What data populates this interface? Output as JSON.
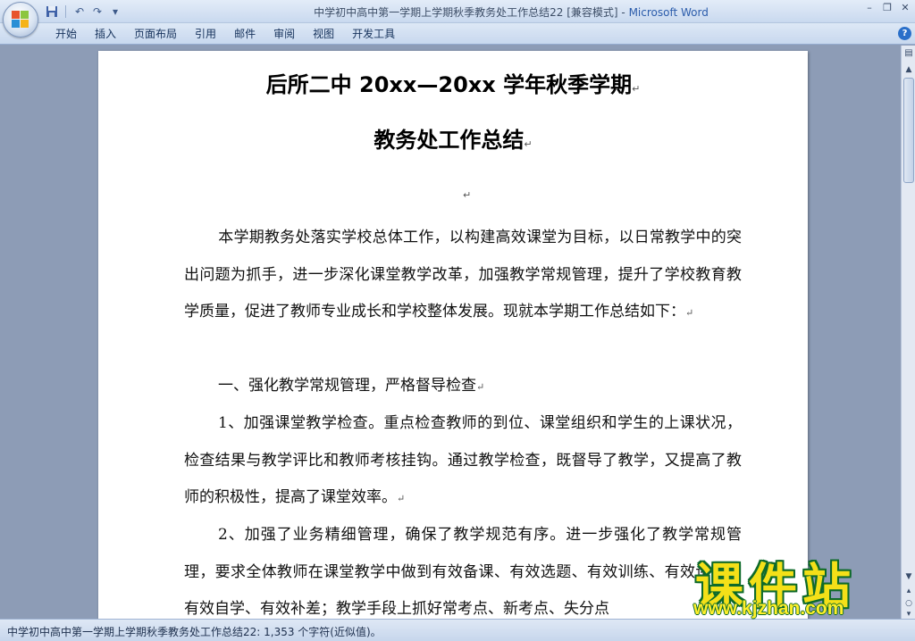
{
  "window": {
    "title_doc": "中学初中高中第一学期上学期秋季教务处工作总结22 [兼容模式]",
    "title_sep": " - ",
    "title_app": "Microsoft Word"
  },
  "ribbon": {
    "tabs": [
      "开始",
      "插入",
      "页面布局",
      "引用",
      "邮件",
      "审阅",
      "视图",
      "开发工具"
    ],
    "help": "?"
  },
  "icons": {
    "save": "save-icon",
    "undo": "undo-icon",
    "redo": "redo-icon",
    "customize": "customize-qat-icon",
    "minimize": "minimize-icon",
    "restore": "restore-icon",
    "close": "close-icon"
  },
  "document": {
    "title_line1": "后所二中 20xx—20xx 学年秋季学期",
    "title_line2": "教务处工作总结",
    "paragraph_mark": "↵",
    "paragraphs": [
      "本学期教务处落实学校总体工作，以构建高效课堂为目标，以日常教学中的突出问题为抓手，进一步深化课堂教学改革，加强教学常规管理，提升了学校教育教学质量，促进了教师专业成长和学校整体发展。现就本学期工作总结如下：",
      "一、强化教学常规管理，严格督导检查",
      "1、加强课堂教学检查。重点检查教师的到位、课堂组织和学生的上课状况，检查结果与教学评比和教师考核挂钩。通过教学检查，既督导了教学，又提高了教师的积极性，提高了课堂效率。",
      "2、加强了业务精细管理，确保了教学规范有序。进一步强化了教学常规管理，要求全体教师在课堂教学中做到有效备课、有效选题、有效训练、有效讲评、有效自学、有效补差；教学手段上抓好常考点、新考点、失分点"
    ]
  },
  "statusbar": {
    "text": "中学初中高中第一学期上学期秋季教务处工作总结22: 1,353 个字符(近似值)。"
  },
  "watermark": {
    "brand": "课件站",
    "url": "www.kjzhan.com"
  }
}
